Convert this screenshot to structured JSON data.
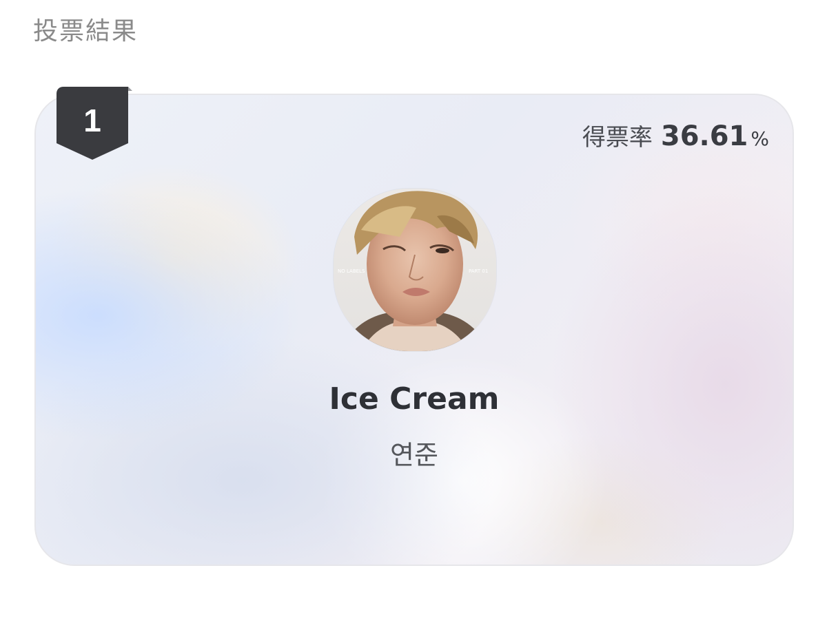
{
  "header": {
    "title": "投票結果"
  },
  "result": {
    "rank": "1",
    "vote_rate_label": "得票率",
    "vote_rate_value": "36.61",
    "vote_rate_unit": "%",
    "song_title": "Ice Cream",
    "artist": "연준",
    "album_art_text_left": "NO LABELS",
    "album_art_text_right": "PART 01"
  },
  "colors": {
    "badge": "#3a3b3f",
    "badge_fold": "#9a9b9f",
    "title_text": "#2e3036",
    "muted_text": "#8a8a8a"
  }
}
